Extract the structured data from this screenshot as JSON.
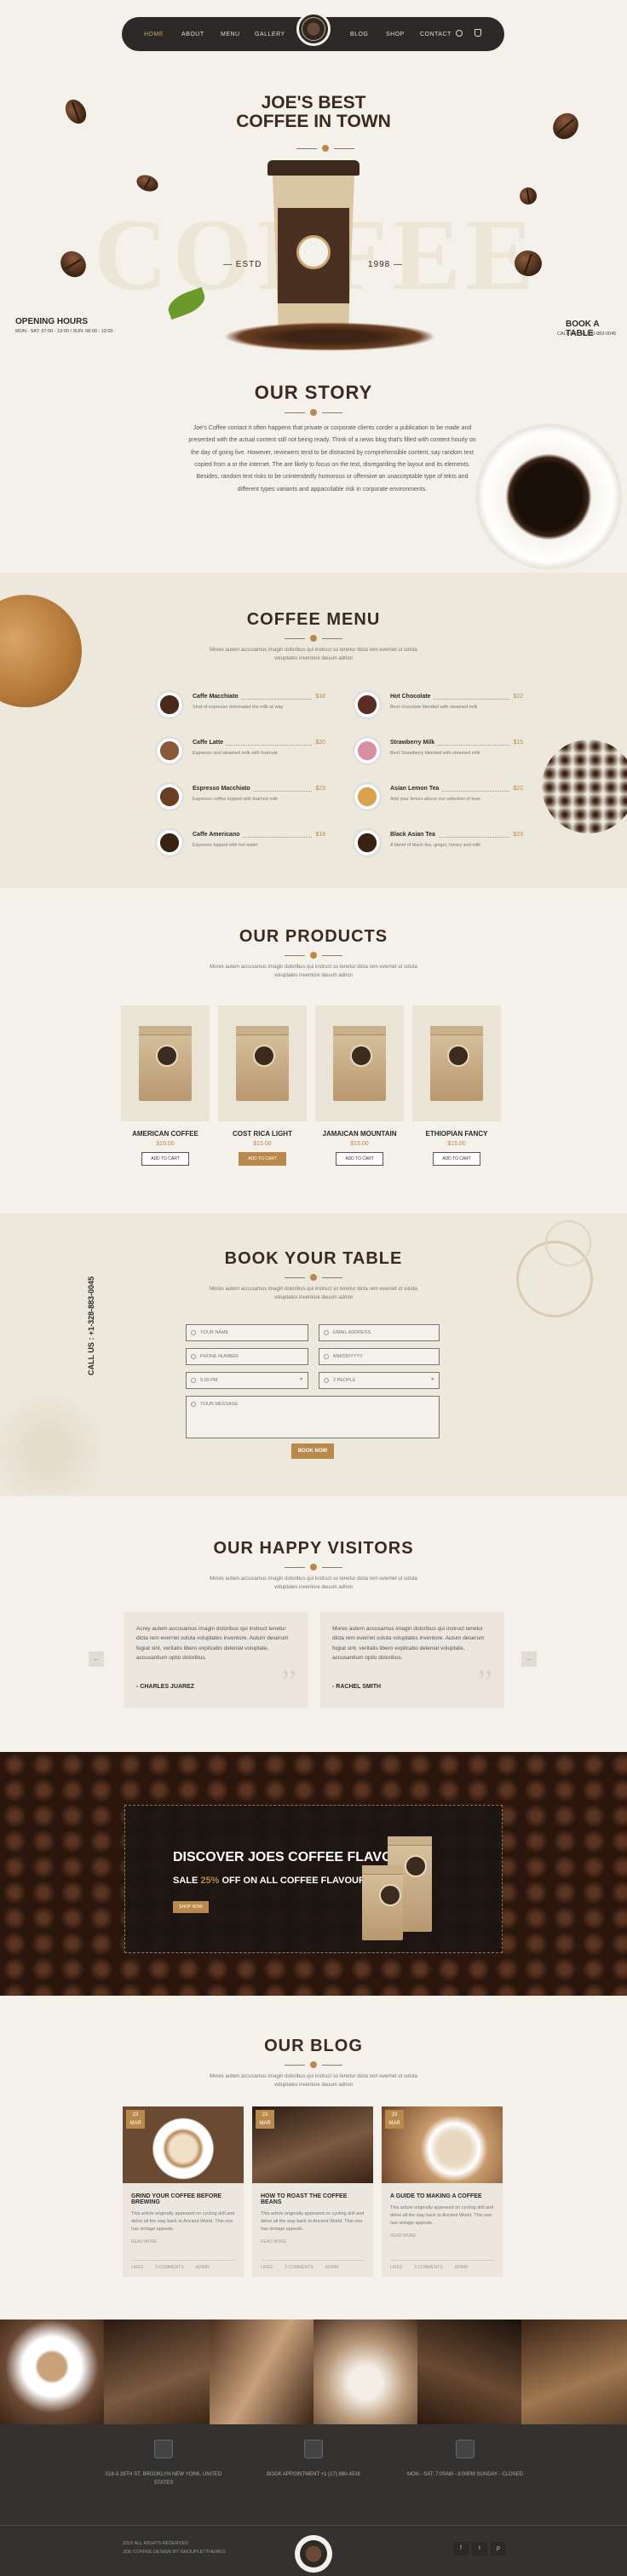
{
  "nav": {
    "items_left": [
      "HOME",
      "ABOUT",
      "MENU",
      "GALLERY"
    ],
    "items_right": [
      "BLOG",
      "SHOP",
      "CONTACT"
    ],
    "search_icon": "search-icon",
    "cart_icon": "cart-icon"
  },
  "hero": {
    "title_line1": "JOE'S BEST",
    "title_line2": "COFFEE IN TOWN",
    "bg_word": "COFFEE",
    "estd": "ESTD",
    "year": "1998",
    "opening_title": "OPENING HOURS",
    "opening_text": "MON - SAT: 07:00 - 19:00 / SUN: 08:00 - 12:00",
    "book_title": "BOOK A TABLE",
    "book_phone": "CALL US : +1 800-883-0045"
  },
  "story": {
    "title": "OUR STORY",
    "text": "Joe's Coffee contact it often happens that private or corporate clients corder a publication to be made and presented with the actual content still not being ready. Think of a news blog that's filled with content hourly on the day of going live. However, reviewers tend to be distracted by comprehensible content, say random text copied from a or the internet. The are likely to focus on the text, disregarding the layout and its elements. Besides, random text risks to be unintendedly humorous or offensive an unacceptable type of tekts and different types variants and appaccilable risk in corporate environments."
  },
  "menu": {
    "title": "COFFEE MENU",
    "subtitle": "Mores autem accusamus imagin doloribus qui instruct so tenetur dicta rem everriet ut soluta voluptates inventore deuum adrion",
    "items": [
      {
        "name": "Caffe Macchiato",
        "price": "$18",
        "desc": "Shot of espresso dominated the milk at way"
      },
      {
        "name": "Hot Chocolate",
        "price": "$22",
        "desc": "Best chocolate blended with steamed milk"
      },
      {
        "name": "Caffe Latte",
        "price": "$20",
        "desc": "Espresso and steamed milk with foamule"
      },
      {
        "name": "Strawberry Milk",
        "price": "$15",
        "desc": "Best Strawberry blended with steamed milk"
      },
      {
        "name": "Espresso Macchiato",
        "price": "$23",
        "desc": "Espresso coffee topped with foamed milk"
      },
      {
        "name": "Asian Lemon Tea",
        "price": "$22",
        "desc": "Add your lemon above our selection of teas"
      },
      {
        "name": "Caffe Americano",
        "price": "$18",
        "desc": "Espresso topped with hot water"
      },
      {
        "name": "Black Asian Tea",
        "price": "$23",
        "desc": "A blend of black tea, ginger, honey and milk"
      }
    ]
  },
  "products": {
    "title": "OUR PRODUCTS",
    "subtitle": "Mores autem accusamus imagin doloribus qui instruct so tenetur dicta rem everriet ut soluta voluptates inventore deuum adrion",
    "items": [
      {
        "name": "AMERICAN COFFEE",
        "price": "$15.00",
        "button": "ADD TO CART"
      },
      {
        "name": "COST RICA LIGHT",
        "price": "$15.00",
        "button": "ADD TO CART"
      },
      {
        "name": "JAMAICAN MOUNTAIN",
        "price": "$15.00",
        "button": "ADD TO CART"
      },
      {
        "name": "ETHIOPIAN FANCY",
        "price": "$15.00",
        "button": "ADD TO CART"
      }
    ]
  },
  "booking": {
    "title": "BOOK YOUR TABLE",
    "subtitle": "Mores autem accusamus imagin doloribus qui instruct so tenetur dicta rem everriet ut soluta voluptates inventore deuum adrion",
    "side": "CALL US : +1-328-883-0045",
    "fields": {
      "name": "YOUR NAME",
      "email": "EMAIL ADDRESS",
      "phone": "PHONE NUMBER",
      "date": "MM/DD/YYYY",
      "time": "5:00 PM",
      "people": "2 PEOPLE",
      "message": "YOUR MESSAGE"
    },
    "button": "BOOK NOW"
  },
  "visitors": {
    "title": "OUR HAPPY VISITORS",
    "subtitle": "Mores autem accusamus imagin doloribus qui instruct so tenetur dicta rem everriet ut soluta voluptates inventore deuum adrion",
    "items": [
      {
        "text": "Acrey autem accusamus imagin doloribus qui instruct tenetur dicta rem everriet soluta voluptates inventore. Autum deserum fugiat sint, veritatis libero expilcabo deleniat voluptate, accusantium optio doloribus.",
        "author": "- CHARLES JUAREZ"
      },
      {
        "text": "Mores autem accusamus imagin doloribus qui instruct tenetur dicta rem everriet soluta voluptates inventore. Autum deserum fugiat sint, veritatis libero expilcabo deleniat voluptate, accusantium optio doloribus.",
        "author": "- RACHEL SMITH"
      }
    ],
    "prev": "←",
    "next": "→"
  },
  "promo": {
    "title": "DISCOVER JOES COFFEE FLAVOURS",
    "line_pre": "SALE ",
    "line_pct": "25%",
    "line_post": " OFF ON ALL COFFEE FLAVOURS",
    "button": "SHOP NOW"
  },
  "blog": {
    "title": "OUR BLOG",
    "subtitle": "Mores autem accusamus imagin doloribus qui instruct so tenetur dicta rem everriet ut soluta voluptates inventore deuum adrion",
    "posts": [
      {
        "day": "23",
        "mon": "MAR",
        "title": "GRIND YOUR COFFEE BEFORE BREWING",
        "text": "This article originally appeared on cycling drill and delve all the way back to Ancient World. This one has vintage appeals.",
        "more": "READ MORE",
        "meta": [
          "LIKES",
          "3 COMMENTS",
          "ADMIN"
        ]
      },
      {
        "day": "23",
        "mon": "MAR",
        "title": "HOW TO ROAST THE COFFEE BEANS",
        "text": "This article originally appeared on cycling drill and delve all the way back to Ancient World. This one has vintage appeals.",
        "more": "READ MORE",
        "meta": [
          "LIKES",
          "3 COMMENTS",
          "ADMIN"
        ]
      },
      {
        "day": "23",
        "mon": "MAR",
        "title": "A GUIDE TO MAKING A COFFEE",
        "text": "This article originally appeared on cycling drill and delve all the way back to Ancient World. This one has vintage appeals.",
        "more": "READ MORE",
        "meta": [
          "LIKES",
          "3 COMMENTS",
          "ADMIN"
        ]
      }
    ]
  },
  "footer": {
    "address": "518-3 26TH ST, BROOKLYN NEW YORK, UNITED STATES",
    "appointment": "BOOK APPOINTMENT +1 (17) 880-4516",
    "hours": "MON - SAT: 7:00AM - 8:00PM SUNDAY - CLOSED",
    "copy1": "2016 ALL RIGHTS RESERVED",
    "copy2": "JOE COFFEE DESIGN BY GROUPLETTHEMES",
    "social": [
      "f",
      "t",
      "p"
    ]
  }
}
